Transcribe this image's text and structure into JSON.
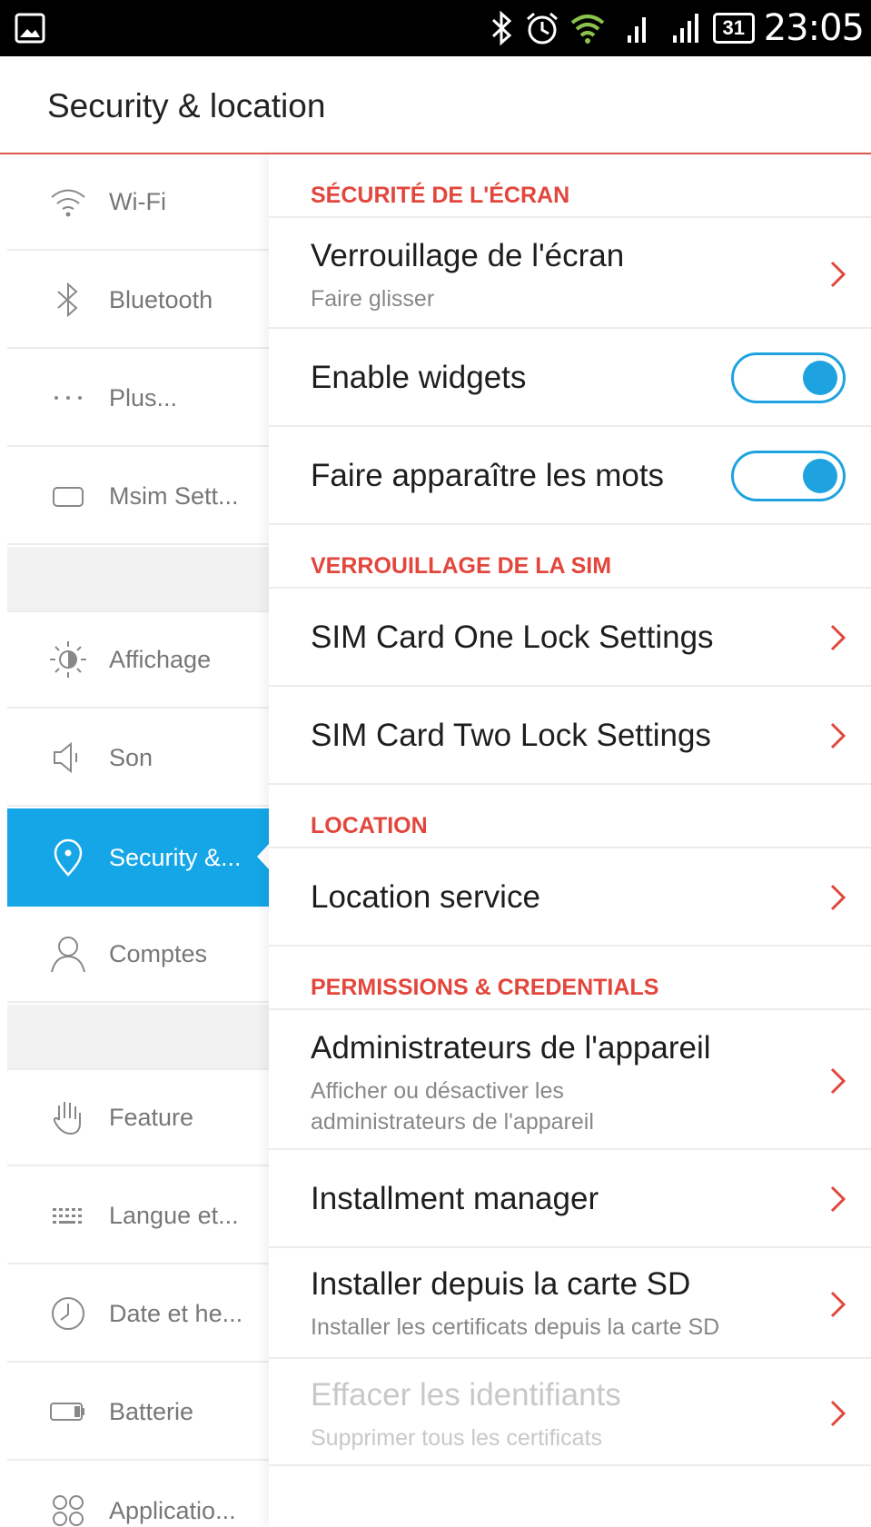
{
  "status_bar": {
    "time": "23:05",
    "calendar_day": "31",
    "icons": [
      "gallery-icon",
      "bluetooth-icon",
      "alarm-icon",
      "wifi-icon",
      "signal-icon",
      "signal-icon",
      "calendar-icon"
    ]
  },
  "header": {
    "title": "Security & location"
  },
  "sidebar": {
    "items": [
      {
        "label": "Wi-Fi",
        "icon": "wifi-icon"
      },
      {
        "label": "Bluetooth",
        "icon": "bluetooth-icon"
      },
      {
        "label": "Plus...",
        "icon": "more-icon"
      },
      {
        "label": "Msim Sett...",
        "icon": "sim-icon"
      },
      {
        "label": "Affichage",
        "icon": "brightness-icon"
      },
      {
        "label": "Son",
        "icon": "speaker-icon"
      },
      {
        "label": "Security &...",
        "icon": "location-pin-icon",
        "active": true
      },
      {
        "label": "Comptes",
        "icon": "person-icon"
      },
      {
        "label": "Feature",
        "icon": "hand-icon"
      },
      {
        "label": "Langue et...",
        "icon": "keyboard-icon"
      },
      {
        "label": "Date et he...",
        "icon": "clock-icon"
      },
      {
        "label": "Batterie",
        "icon": "battery-icon"
      },
      {
        "label": "Applicatio...",
        "icon": "apps-icon"
      }
    ]
  },
  "main": {
    "sections": {
      "screen_security": "SÉCURITÉ DE L'ÉCRAN",
      "sim_lock": "VERROUILLAGE DE LA SIM",
      "location": "LOCATION",
      "permissions": "PERMISSIONS & CREDENTIALS"
    },
    "rows": {
      "screen_lock": {
        "title": "Verrouillage de l'écran",
        "subtitle": "Faire glisser"
      },
      "enable_widgets": {
        "title": "Enable widgets",
        "on": true
      },
      "show_words": {
        "title": "Faire apparaître les mots",
        "on": true
      },
      "sim_one": {
        "title": "SIM Card One Lock Settings"
      },
      "sim_two": {
        "title": "SIM Card Two Lock Settings"
      },
      "location_service": {
        "title": "Location service"
      },
      "device_admins": {
        "title": "Administrateurs de l'appareil",
        "subtitle_1": "Afficher ou désactiver les",
        "subtitle_2": "administrateurs de l'appareil"
      },
      "install_manager": {
        "title": "Installment manager"
      },
      "install_sd": {
        "title": "Installer depuis la carte SD",
        "subtitle": "Installer les certificats depuis la carte SD"
      },
      "clear_credentials": {
        "title": "Effacer les identifiants",
        "subtitle": "Supprimer tous les certificats",
        "disabled": true
      }
    }
  },
  "colors": {
    "accent_red": "#e2463c",
    "accent_blue": "#14a6e6",
    "toggle_blue": "#1fa3e0"
  }
}
